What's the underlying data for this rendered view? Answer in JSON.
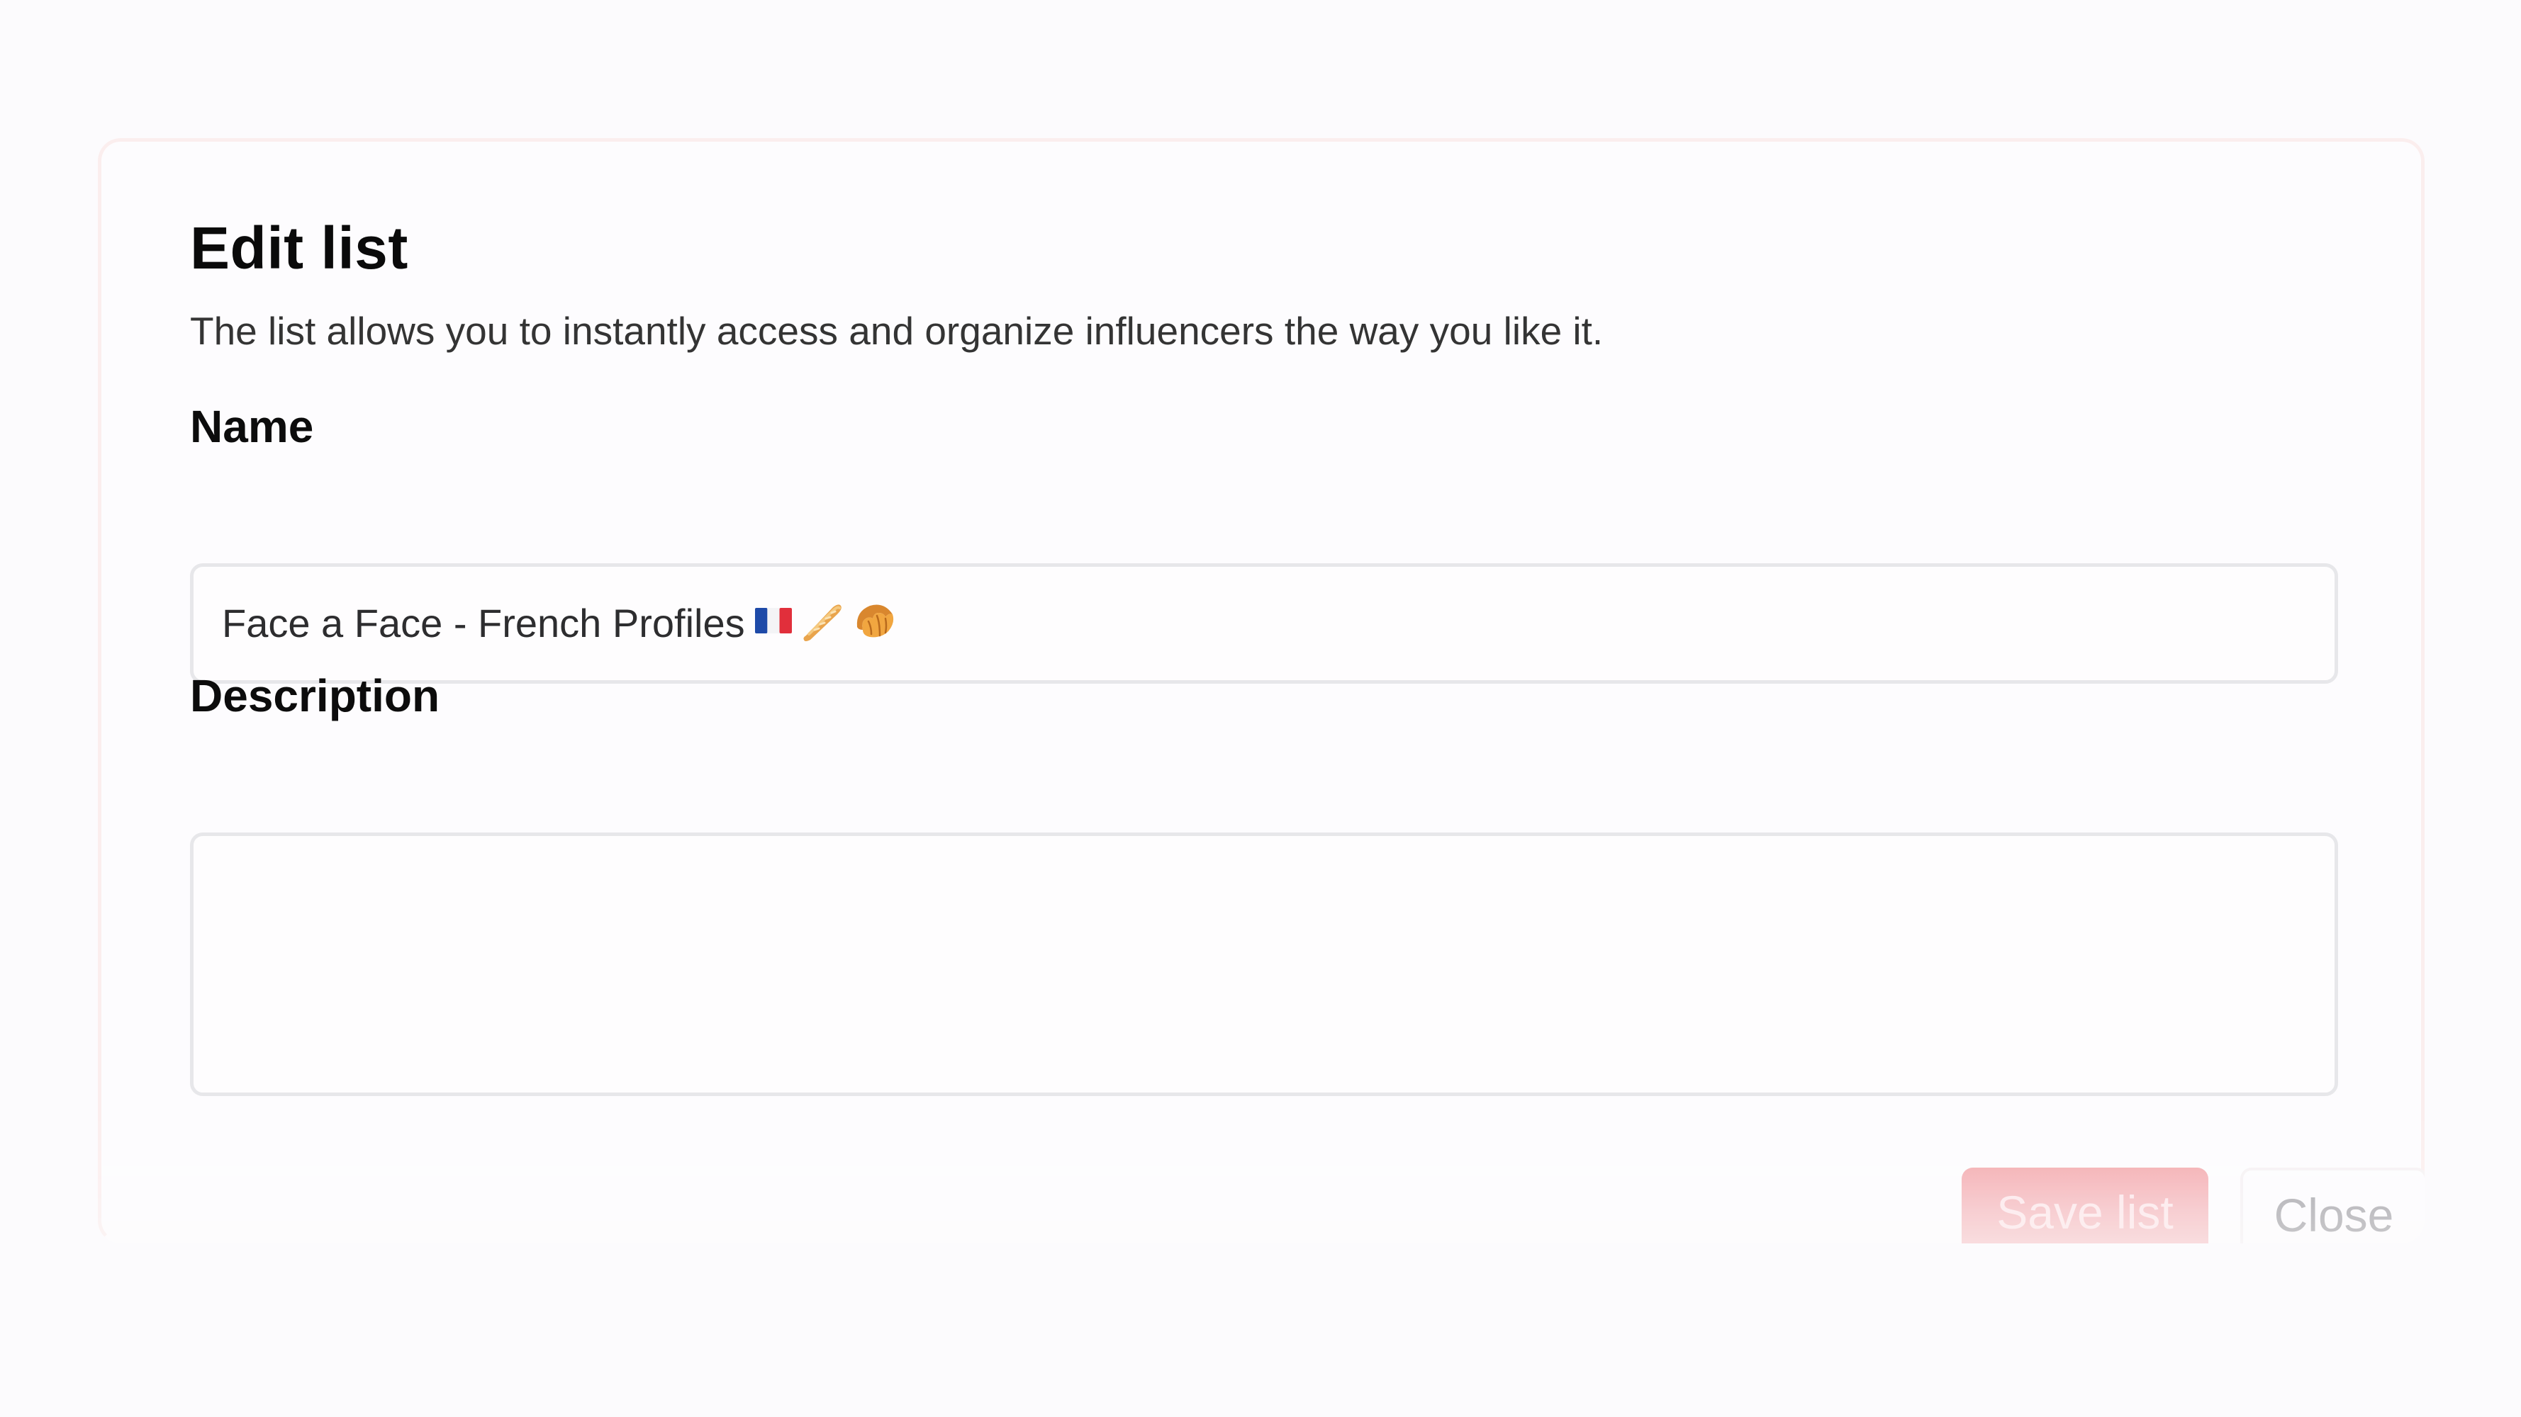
{
  "dialog": {
    "title": "Edit list",
    "subtitle": "The list allows you to instantly access and organize influencers the way you like it."
  },
  "form": {
    "name_label": "Name",
    "name_value": "Face a Face - French Profiles",
    "name_emojis": [
      "flag-france-icon",
      "baguette-icon",
      "croissant-icon"
    ],
    "description_label": "Description",
    "description_value": ""
  },
  "actions": {
    "save_label": "Save list",
    "close_label": "Close"
  },
  "colors": {
    "save_button": "#f5b7bb",
    "save_text": "#fde7e9",
    "close_text": "#a6a5a9",
    "border": "#e7e7ea"
  }
}
